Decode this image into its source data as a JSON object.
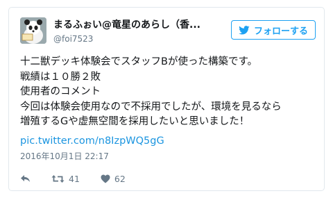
{
  "tweet": {
    "display_name": "まるふぉい@竜星のあらし（香...",
    "handle": "@foi7523",
    "follow_label": "フォローする",
    "lines": [
      "十二獣デッキ体験会でスタッフBが使った構築です。",
      "戦績は１０勝２敗",
      "使用者のコメント",
      "今回は体験会使用なので不採用でしたが、環境を見るなら",
      "増殖するGや虚無空間を採用したいと思いました！"
    ],
    "link": "pic.twitter.com/n8IzpWQ5gG",
    "timestamp": "2016年10月1日 22:17",
    "retweet_count": "41",
    "like_count": "62"
  },
  "colors": {
    "accent": "#1da1f2",
    "link": "#1b95e0",
    "muted": "#657786",
    "border": "#e1e8ed"
  },
  "icons": [
    "avatar",
    "twitter-bird-icon",
    "reply-icon",
    "retweet-icon",
    "heart-icon"
  ]
}
